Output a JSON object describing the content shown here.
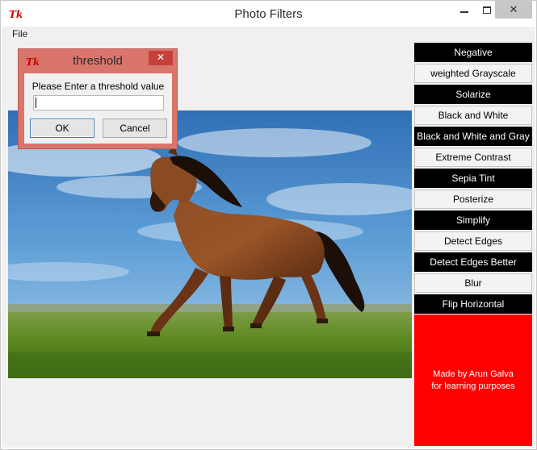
{
  "window": {
    "title": "Photo Filters",
    "icon": "tk-feather-icon",
    "close_glyph": "✕"
  },
  "menu": {
    "file_label": "File"
  },
  "photo": {
    "subject": "brown horse galloping in a grassy field under a blue sky"
  },
  "filters": [
    {
      "label": "Negative",
      "style": "dark"
    },
    {
      "label": "weighted Grayscale",
      "style": "light"
    },
    {
      "label": "Solarize",
      "style": "dark"
    },
    {
      "label": "Black and White",
      "style": "light"
    },
    {
      "label": "Black and White and Gray",
      "style": "dark"
    },
    {
      "label": "Extreme Contrast",
      "style": "light"
    },
    {
      "label": "Sepia Tint",
      "style": "dark"
    },
    {
      "label": "Posterize",
      "style": "light"
    },
    {
      "label": "Simplify",
      "style": "dark"
    },
    {
      "label": "Detect Edges",
      "style": "light"
    },
    {
      "label": "Detect Edges Better",
      "style": "dark"
    },
    {
      "label": "Blur",
      "style": "light"
    },
    {
      "label": "Flip Horizontal",
      "style": "dark"
    }
  ],
  "credit": {
    "line1": "Made by Arun Galva",
    "line2": "for learning purposes",
    "background": "#ff0000"
  },
  "dialog": {
    "title": "threshold",
    "close_glyph": "✕",
    "prompt": "Please Enter a threshold value",
    "input_value": "",
    "ok_label": "OK",
    "cancel_label": "Cancel",
    "frame_color": "#d9756b"
  }
}
